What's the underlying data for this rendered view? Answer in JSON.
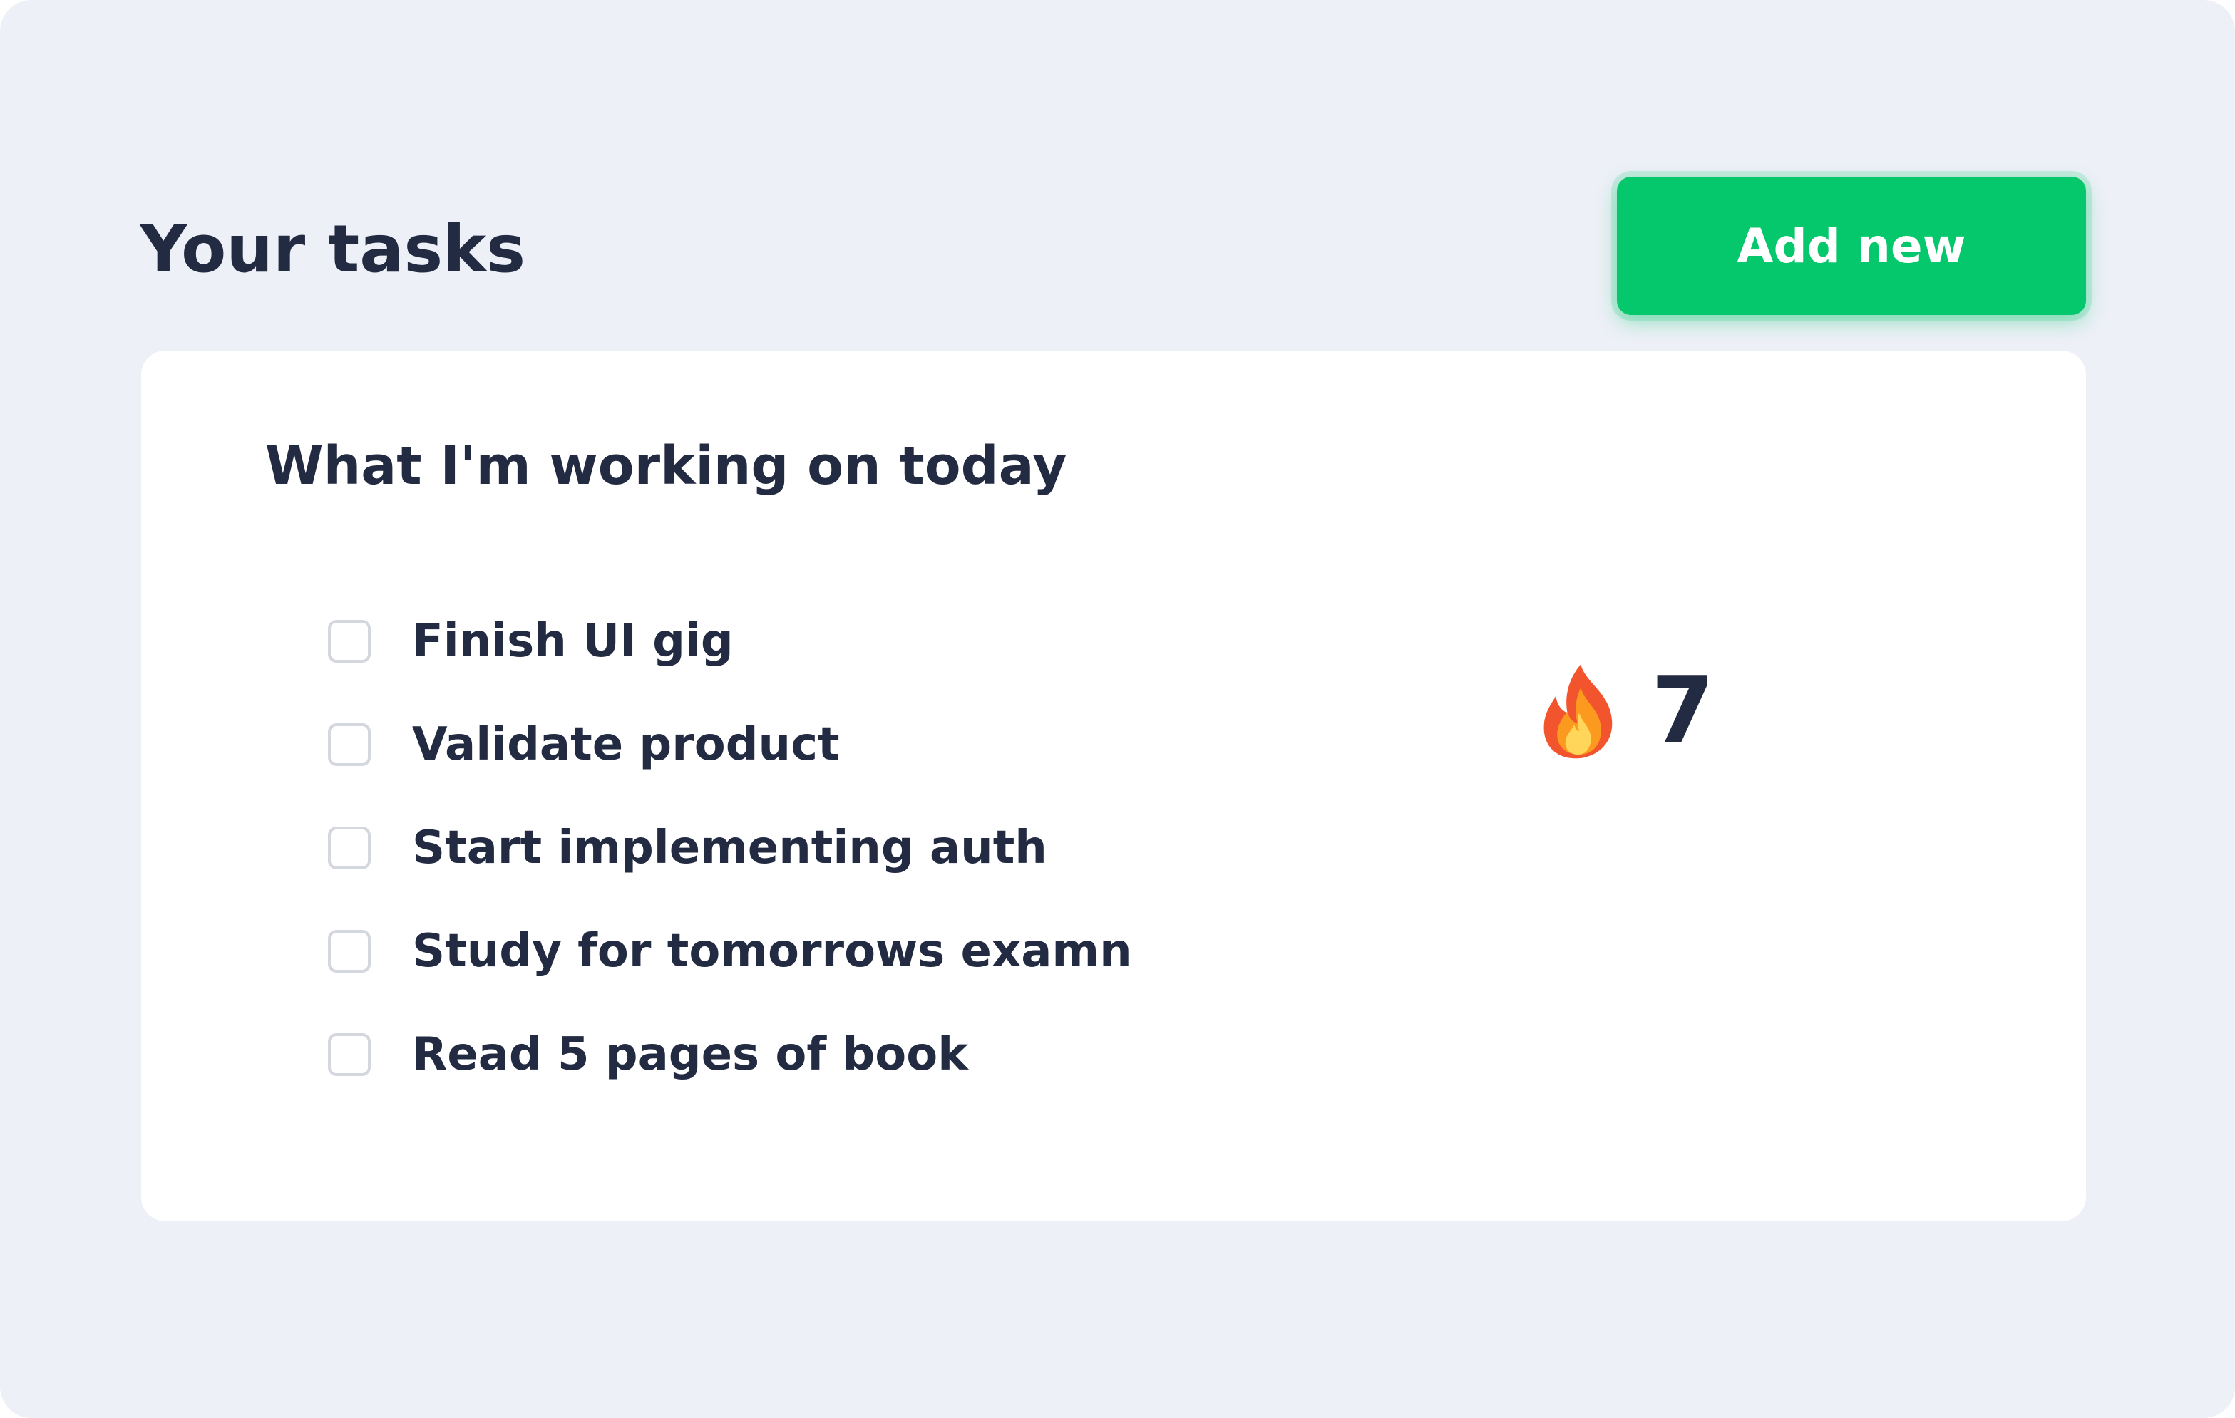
{
  "header": {
    "title": "Your tasks",
    "add_button_label": "Add new"
  },
  "card": {
    "heading": "What I'm working on today",
    "tasks": [
      {
        "label": "Finish UI gig",
        "checked": false
      },
      {
        "label": "Validate product",
        "checked": false
      },
      {
        "label": "Start implementing auth",
        "checked": false
      },
      {
        "label": "Study for tomorrows examn",
        "checked": false
      },
      {
        "label": "Read 5 pages of book",
        "checked": false
      }
    ],
    "streak": {
      "icon": "flame-icon",
      "count": "7"
    }
  },
  "colors": {
    "page_background": "#edf0f7",
    "card_background": "#ffffff",
    "accent_green": "#05c76b",
    "text_dark": "#232b42",
    "checkbox_border": "#d4d7de"
  }
}
